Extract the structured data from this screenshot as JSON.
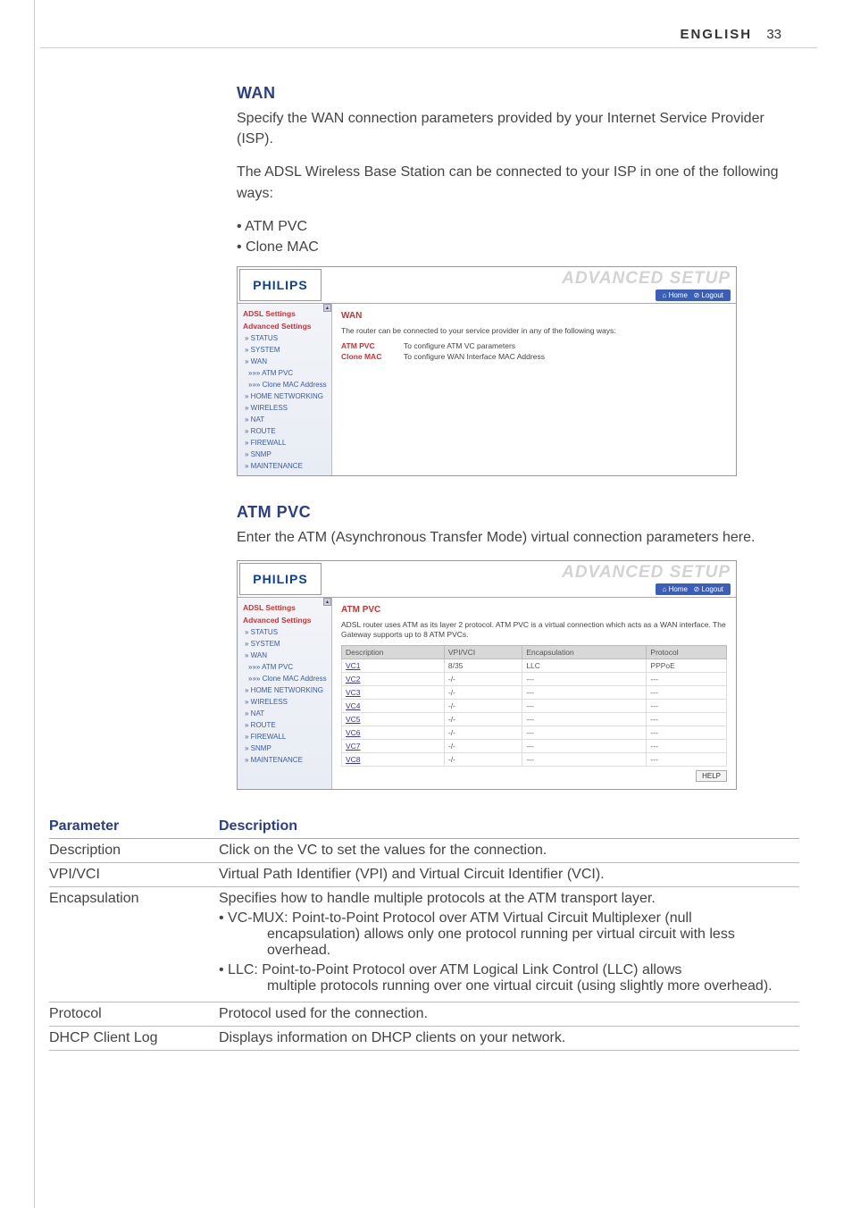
{
  "header": {
    "language": "ENGLISH",
    "page_number": "33"
  },
  "section_wan": {
    "title": "WAN",
    "para1": "Specify the WAN connection parameters provided by your Internet Service Provider (ISP).",
    "para2": "The ADSL Wireless Base Station can be connected to your ISP in one of the following ways:",
    "bullet1": "• ATM PVC",
    "bullet2": "• Clone MAC"
  },
  "section_atm": {
    "title": "ATM PVC",
    "para1": "Enter the ATM (Asynchronous Transfer Mode) virtual connection parameters here."
  },
  "ss_common": {
    "logo": "PHILIPS",
    "adv_title": "ADVANCED SETUP",
    "util_home": "⌂ Home",
    "util_logout": "⊘ Logout",
    "nav_h1": "ADSL Settings",
    "nav_h2": "Advanced Settings",
    "nav": {
      "status": "» STATUS",
      "system": "» SYSTEM",
      "wan": "» WAN",
      "atm": "»»» ATM PVC",
      "clone": "»»» Clone MAC Address",
      "home": "» HOME NETWORKING",
      "wireless": "» WIRELESS",
      "nat": "» NAT",
      "route": "» ROUTE",
      "firewall": "» FIREWALL",
      "snmp": "» SNMP",
      "maint": "» MAINTENANCE"
    }
  },
  "ss1": {
    "heading": "WAN",
    "text": "The router can be connected to your service provider in any of the following ways:",
    "r1k": "ATM PVC",
    "r1v": "To configure ATM VC parameters",
    "r2k": "Clone MAC",
    "r2v": "To configure WAN Interface MAC Address"
  },
  "ss2": {
    "heading": "ATM PVC",
    "text": "ADSL router uses ATM as its layer 2 protocol. ATM PVC is a virtual connection which acts as a WAN interface. The Gateway supports up to 8 ATM PVCs.",
    "help": "HELP",
    "th": {
      "desc": "Description",
      "vpi": "VPI/VCI",
      "enc": "Encapsulation",
      "proto": "Protocol"
    },
    "rows": [
      {
        "d": "VC1",
        "v": "8/35",
        "e": "LLC",
        "p": "PPPoE"
      },
      {
        "d": "VC2",
        "v": "-/-",
        "e": "---",
        "p": "---"
      },
      {
        "d": "VC3",
        "v": "-/-",
        "e": "---",
        "p": "---"
      },
      {
        "d": "VC4",
        "v": "-/-",
        "e": "---",
        "p": "---"
      },
      {
        "d": "VC5",
        "v": "-/-",
        "e": "---",
        "p": "---"
      },
      {
        "d": "VC6",
        "v": "-/-",
        "e": "---",
        "p": "---"
      },
      {
        "d": "VC7",
        "v": "-/-",
        "e": "---",
        "p": "---"
      },
      {
        "d": "VC8",
        "v": "-/-",
        "e": "---",
        "p": "---"
      }
    ]
  },
  "ptable": {
    "h1": "Parameter",
    "h2": "Description",
    "rows": [
      {
        "p": "Description",
        "d": "Click on the VC to set the values for the connection."
      },
      {
        "p": "VPI/VCI",
        "d": "Virtual Path Identifier (VPI) and Virtual Circuit Identifier (VCI)."
      },
      {
        "p": "Encapsulation",
        "d": "Specifies how to handle multiple protocols at the ATM transport layer.",
        "b1a": "• VC-MUX: Point-to-Point Protocol over ATM Virtual Circuit Multiplexer (null",
        "b1b": "encapsulation) allows only one protocol running per virtual circuit with less overhead.",
        "b2a": "• LLC: Point-to-Point Protocol over ATM Logical Link Control (LLC) allows",
        "b2b": "multiple protocols running over one virtual circuit (using slightly more overhead)."
      },
      {
        "p": "Protocol",
        "d": "Protocol used for the connection."
      },
      {
        "p": "DHCP Client Log",
        "d": "Displays information on DHCP clients on your network."
      }
    ]
  }
}
